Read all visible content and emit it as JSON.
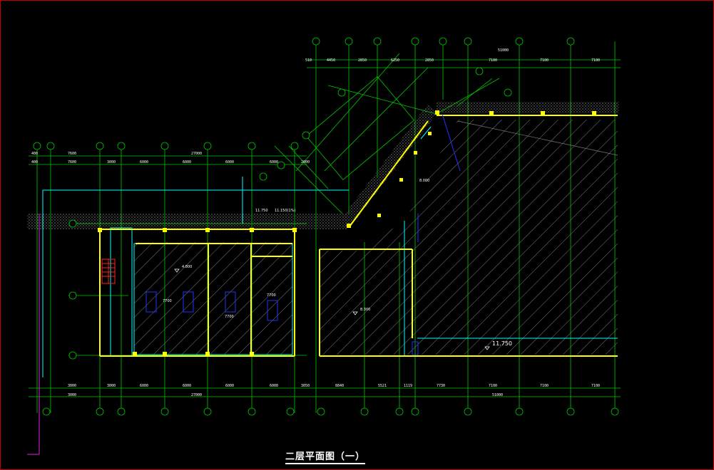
{
  "drawing": {
    "title": "二层平面图（一）",
    "colors": {
      "background": "#000000",
      "grid": "#00c800",
      "wall": "#ffff00",
      "hatch": "#c8c8c8",
      "cyan": "#00ffff",
      "blue": "#1e32ff",
      "red": "#ff2020",
      "frame": "#c00000"
    },
    "left_top_dims_row1": [
      "7600",
      "27000",
      "6000",
      "2000"
    ],
    "left_top_dims_row2": [
      "7600",
      "3000",
      "6000",
      "6000",
      "6000",
      "6000",
      "2000"
    ],
    "left_top_offsets": [
      "400",
      "400"
    ],
    "left_bottom_dims_row1": [
      "3000",
      "3000",
      "6000",
      "6000",
      "6000",
      "6000",
      "3050"
    ],
    "left_bottom_dims_row2": [
      "3000",
      "27000"
    ],
    "right_top_dims_row1": [
      "51000"
    ],
    "right_top_dims_row2": [
      "4450",
      "2850",
      "6250",
      "2850",
      "7100",
      "7100",
      "7100"
    ],
    "right_top_offset": "510",
    "right_bottom_dims_row1": [
      "8840",
      "5521",
      "1119",
      "7730",
      "7100",
      "7100",
      "7100"
    ],
    "right_bottom_dims_row2": [
      "51000"
    ],
    "elevations": [
      "4.800",
      "8.300",
      "11.750",
      "8.000"
    ],
    "slope_notes": [
      "11.750",
      "11.150(1%)"
    ],
    "left_rooms": [
      "7700",
      "7700",
      "7700"
    ]
  }
}
